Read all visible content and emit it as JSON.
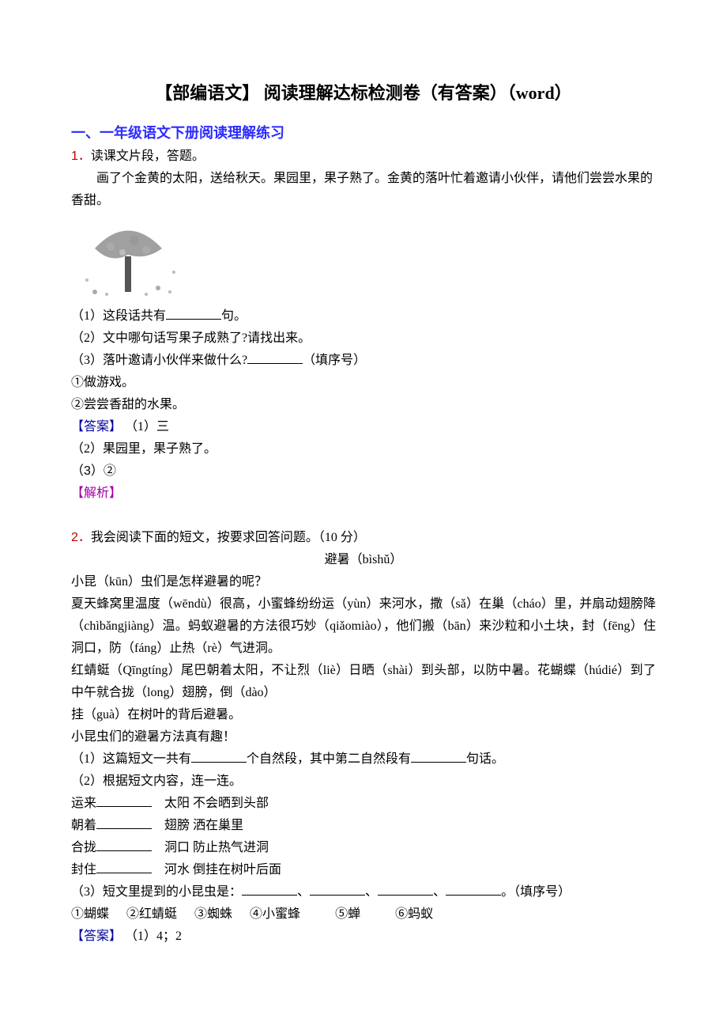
{
  "title": "【部编语文】 阅读理解达标检测卷（有答案）（word）",
  "section_heading": "一、一年级语文下册阅读理解练习",
  "q1": {
    "number": "1．",
    "stem": "读课文片段，答题。",
    "passage_l1": "画了个金黄的太阳，送给秋天。果园里，果子熟了。金黄的落叶忙着邀请小伙伴，请他们尝尝水果的香甜。",
    "sub1_a": "（1）这段话共有",
    "sub1_b": "句。",
    "sub2": "（2）文中哪句话写果子成熟了?请找出来。",
    "sub3_a": "（3）落叶邀请小伙伴来做什么?",
    "sub3_b": "（填序号）",
    "opt1": "①做游戏。",
    "opt2": "②尝尝香甜的水果。",
    "answer_label": "【答案】",
    "ans1": "（1）三",
    "ans2": "（2）果园里，果子熟了。",
    "ans3": "（3）②",
    "analysis_label": "【解析】"
  },
  "q2": {
    "number": "2．",
    "stem": "我会阅读下面的短文，按要求回答问题。（10 分）",
    "title": "避暑（bìshǔ）",
    "p1": "小昆（kūn）虫们是怎样避暑的呢？",
    "p2": "夏天蜂窝里温度（wēndù）很高，小蜜蜂纷纷运（yùn）来河水，撒（sǎ）在巢（cháo）里，并扇动翅膀降（chìbǎngjiàng）温。蚂蚁避暑的方法很巧妙（qiǎomiào），他们搬（bān）来沙粒和小土块，封（fēng）住洞口，防（fáng）止热（rè）气进洞。",
    "p3": "红蜻蜓（Qīngtíng）尾巴朝着太阳，不让烈（liè）日晒（shài）到头部，以防中暑。花蝴蝶（húdié）到了中午就合拢（long）翅膀，倒（dào）",
    "p4": "挂（guà）在树叶的背后避暑。",
    "p5": "小昆虫们的避暑方法真有趣！",
    "sub1_a": "（1）这篇短文一共有",
    "sub1_b": "个自然段，其中第二自然段有",
    "sub1_c": "句话。",
    "sub2": "（2）根据短文内容，连一连。",
    "row1_a": "运来",
    "row1_b": "太阳    不会晒到头部",
    "row2_a": "朝着",
    "row2_b": "翅膀    洒在巢里",
    "row3_a": "合拢",
    "row3_b": "洞口    防止热气进洞",
    "row4_a": "封住",
    "row4_b": "河水    倒挂在树叶后面",
    "sub3_a": "（3）短文里提到的小昆虫是：",
    "sub3_b": "、",
    "sub3_c": "、",
    "sub3_d": "、",
    "sub3_e": "。（填序号）",
    "opts_l1_1": "①蝴蝶",
    "opts_l1_2": "②红蜻蜓",
    "opts_l1_3": "③蜘蛛",
    "opts_l1_4": "④小蜜蜂",
    "opts_l1_5": "⑤蝉",
    "opts_l1_6": "⑥蚂蚁",
    "answer_label": "【答案】",
    "ans1": "（1）4；2"
  }
}
